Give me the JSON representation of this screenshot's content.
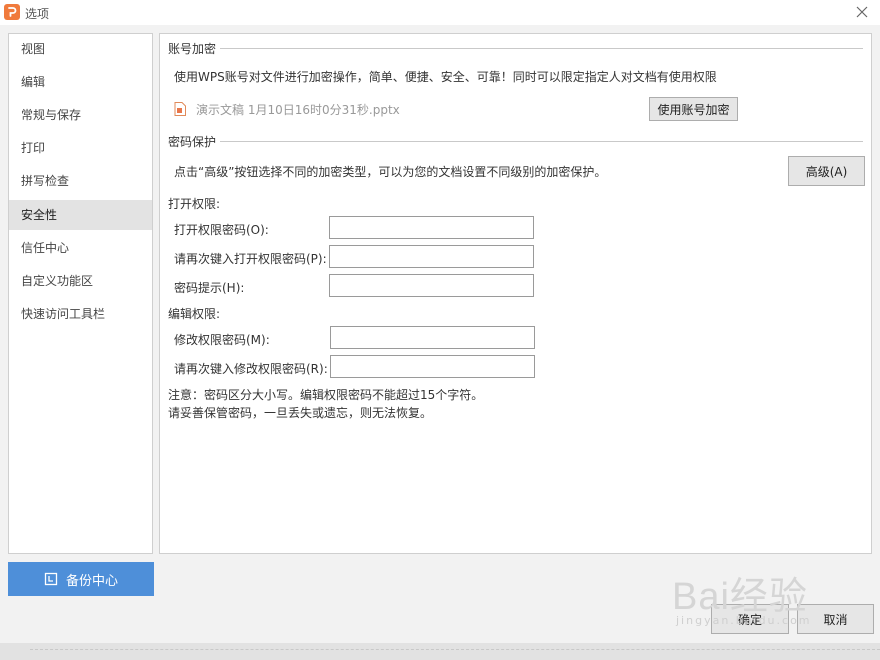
{
  "window": {
    "title": "选项"
  },
  "sidebar": {
    "items": [
      {
        "label": "视图"
      },
      {
        "label": "编辑"
      },
      {
        "label": "常规与保存"
      },
      {
        "label": "打印"
      },
      {
        "label": "拼写检查"
      },
      {
        "label": "安全性"
      },
      {
        "label": "信任中心"
      },
      {
        "label": "自定义功能区"
      },
      {
        "label": "快速访问工具栏"
      }
    ],
    "active": "安全性"
  },
  "backup": {
    "label": "备份中心"
  },
  "account_encrypt": {
    "heading": "账号加密",
    "description": "使用WPS账号对文件进行加密操作，简单、便捷、安全、可靠！同时可以限定指定人对文档有使用权限",
    "file_name": "演示文稿 1月10日16时0分31秒.pptx",
    "button": "使用账号加密"
  },
  "password_protect": {
    "heading": "密码保护",
    "description": "点击“高级”按钮选择不同的加密类型，可以为您的文档设置不同级别的加密保护。",
    "advanced_button": "高级(A)"
  },
  "open_perm": {
    "heading": "打开权限:",
    "password_label": "打开权限密码(O):",
    "confirm_label": "请再次键入打开权限密码(P):",
    "hint_label": "密码提示(H):",
    "password_value": "",
    "confirm_value": "",
    "hint_value": ""
  },
  "edit_perm": {
    "heading": "编辑权限:",
    "password_label": "修改权限密码(M):",
    "confirm_label": "请再次键入修改权限密码(R):",
    "password_value": "",
    "confirm_value": ""
  },
  "notes": {
    "line1": "注意：密码区分大小写。编辑权限密码不能超过15个字符。",
    "line2": "请妥善保管密码，一旦丢失或遗忘，则无法恢复。"
  },
  "footer": {
    "ok": "确定",
    "cancel": "取消"
  },
  "watermark": {
    "logo": "Bai经验",
    "url": "jingyan.baidu.com"
  }
}
